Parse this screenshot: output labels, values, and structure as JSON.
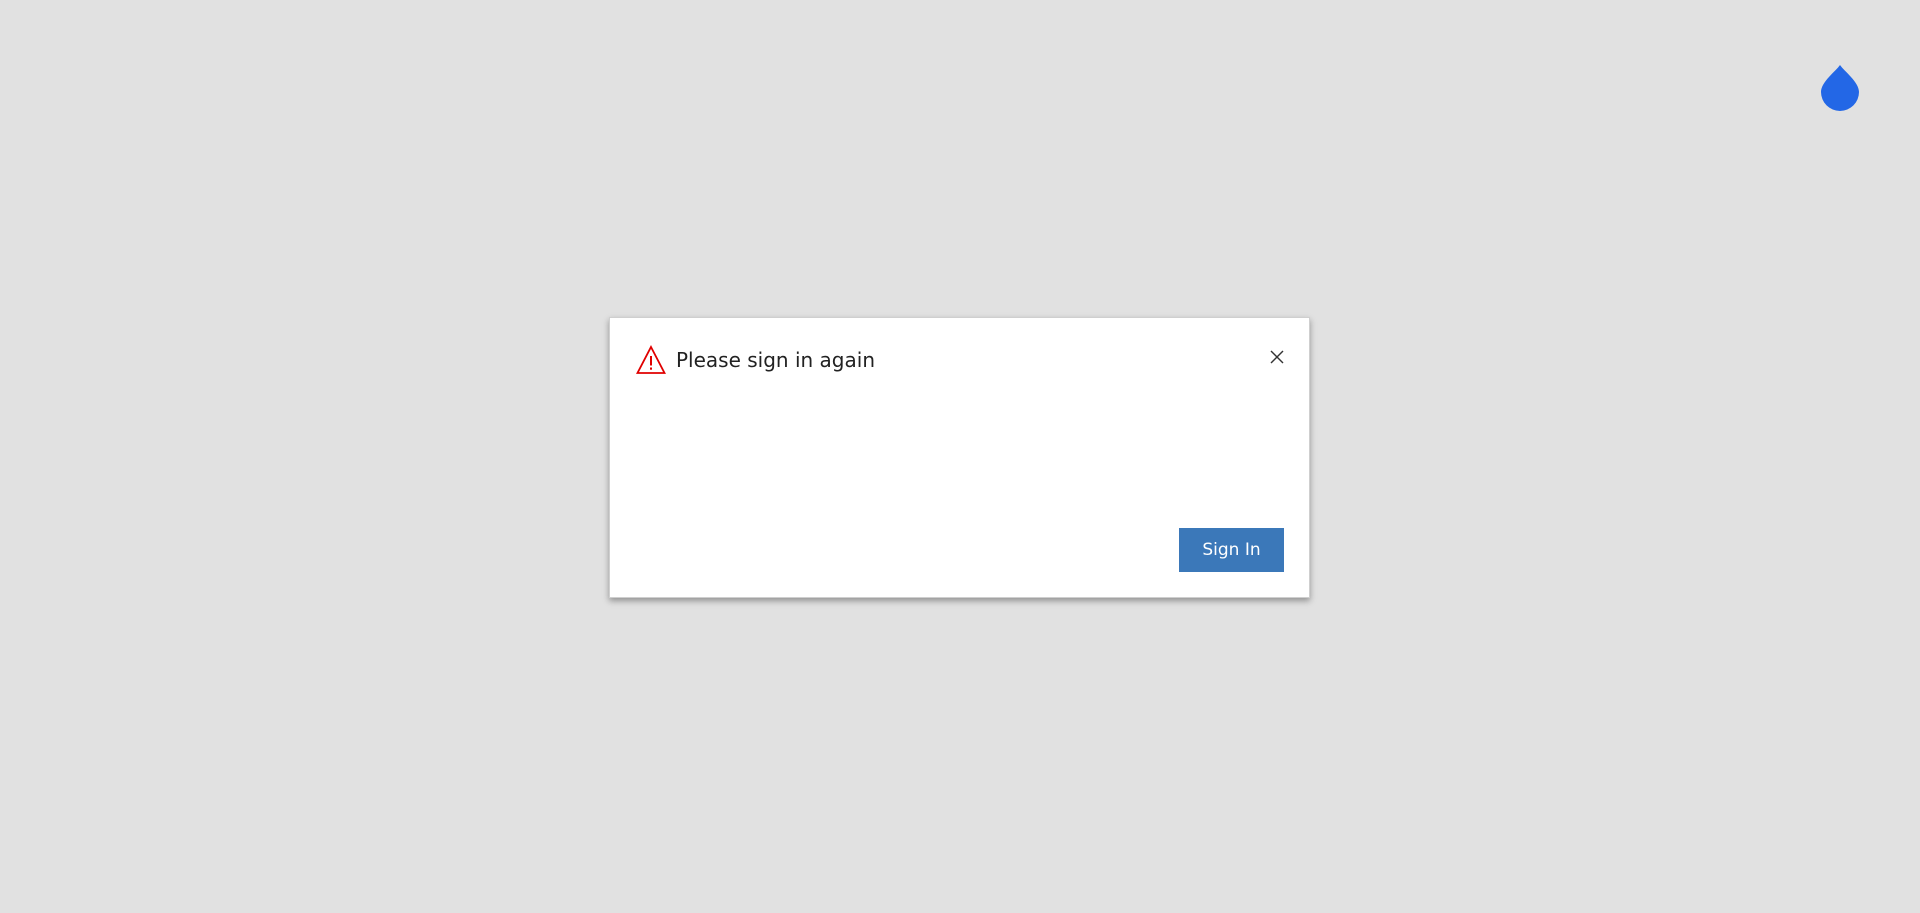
{
  "app": {
    "logo_icon": "droplet-icon",
    "logo_color": "#2367e6"
  },
  "dialog": {
    "icon": "warning-icon",
    "icon_color": "#e00000",
    "title": "Please sign in again",
    "close_icon": "close-icon",
    "primary_button_label": "Sign In",
    "primary_button_color": "#3b78b9"
  }
}
